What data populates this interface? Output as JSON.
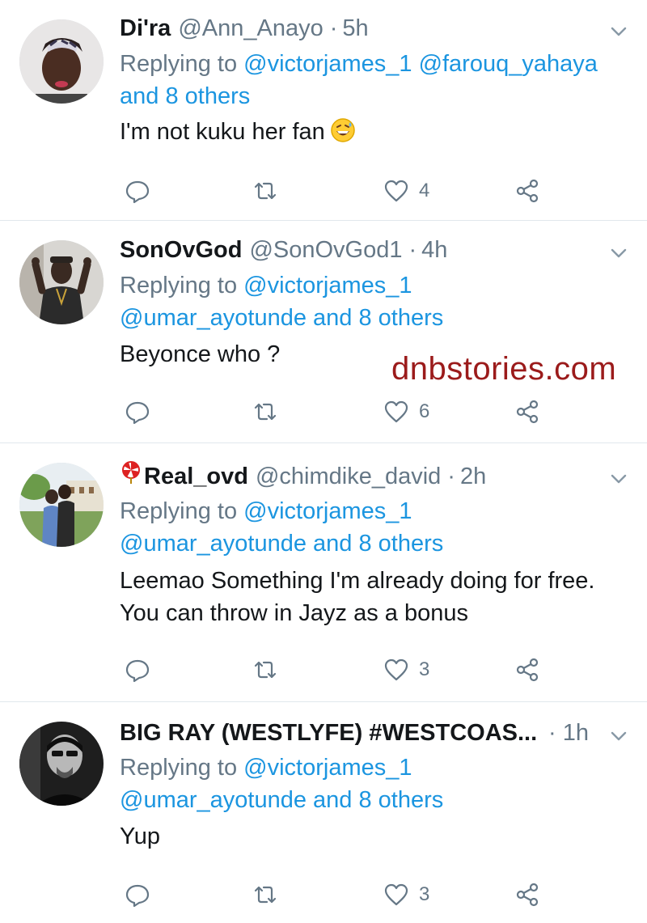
{
  "watermark": "dnbstories.com",
  "colors": {
    "link": "#1b95e0",
    "muted": "#657786",
    "text": "#14171a",
    "divider": "#e1e8ed",
    "watermark": "#9b1b1b"
  },
  "tweets": [
    {
      "display_name": "Di'ra",
      "handle": "@Ann_Anayo",
      "separator": "·",
      "time": "5h",
      "replying_prefix": "Replying to",
      "mentions": [
        "@victorjames_1",
        "@farouq_yahaya"
      ],
      "others": "and 8 others",
      "text": "I'm not kuku her fan",
      "emoji": "grinning-sweat-emoji",
      "likes": "4"
    },
    {
      "display_name": "SonOvGod",
      "handle": "@SonOvGod1",
      "separator": "·",
      "time": "4h",
      "replying_prefix": "Replying to",
      "mentions": [
        "@victorjames_1",
        "@umar_ayotunde"
      ],
      "others": "and 8 others",
      "text": "Beyonce who ?",
      "likes": "6"
    },
    {
      "display_name": "Real_ovd",
      "name_emoji": "pinwheel-emoji",
      "handle": "@chimdike_david",
      "separator": "·",
      "time": "2h",
      "replying_prefix": "Replying to",
      "mentions": [
        "@victorjames_1",
        "@umar_ayotunde"
      ],
      "others": "and 8 others",
      "text_line1": "Leemao Something I'm already doing for free.",
      "text_line2": "You can throw in Jayz as a bonus",
      "likes": "3"
    },
    {
      "display_name": "BIG RAY (WESTLYFE) #WESTCOAS...",
      "separator": "·",
      "time": "1h",
      "replying_prefix": "Replying to",
      "mentions": [
        "@victorjames_1",
        "@umar_ayotunde"
      ],
      "others": "and 8 others",
      "text": "Yup",
      "likes": "3"
    }
  ],
  "icons": {
    "reply": "reply-icon",
    "retweet": "retweet-icon",
    "like": "heart-icon",
    "share": "share-icon",
    "more": "chevron-down-icon"
  }
}
